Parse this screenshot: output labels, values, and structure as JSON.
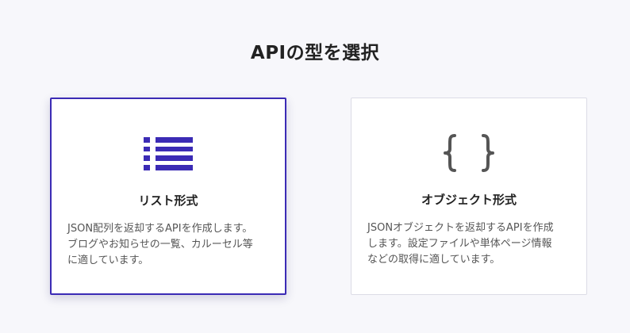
{
  "page": {
    "title": "APIの型を選択"
  },
  "cards": [
    {
      "title": "リスト形式",
      "description": "JSON配列を返却するAPIを作成します。\nブログやお知らせの一覧、カルーセル等\nに適しています。",
      "icon": "list-icon",
      "selected": true
    },
    {
      "title": "オブジェクト形式",
      "description": "JSONオブジェクトを返却するAPIを作成\nします。設定ファイルや単体ページ情報\nなどの取得に適しています。",
      "icon": "curly-braces-icon",
      "selected": false
    }
  ],
  "colors": {
    "accent": "#3b2bb5",
    "icon_gray": "#555555",
    "background": "#f7f7fb"
  }
}
